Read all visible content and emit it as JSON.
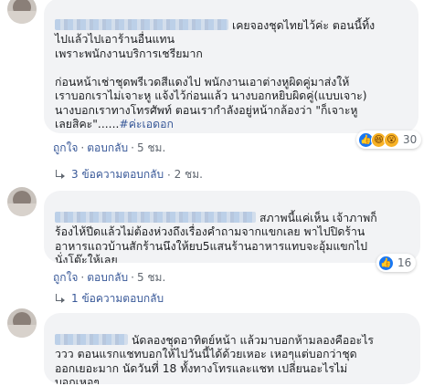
{
  "comments": [
    {
      "name": "",
      "text_first": "เคยจองชุดไทยไว้ค่ะ ตอนนี้ทิ้ง",
      "text_rest": "ไปแล้วไปเอาร้านอื่นแทน\nเพราะพนักงานบริการเชรียมาก\n\nก่อนหน้าเช่าชุดพรีเวดสีแดงไป พนักงานเอาต่างหูผิดคู่มาส่งให้\nเราบอกเราไม่เจาะหู แจ้งไว้ก่อนแล้ว นางบอกหยิบผิดคู่(แบบเจาะ)\nนางบอกเราทางโทรศัพท์ ตอนเรากำลังอยู่หน้ากล้องว่า \"ก็เจาะหู\nเลยสิคะ\"......",
      "hashtag": "#ค่ะเอดอก",
      "actions": {
        "like": "ถูกใจ",
        "reply": "ตอบกลับ",
        "time": "5 ชม."
      },
      "reactions": {
        "icons": [
          "like-icon",
          "haha-icon",
          "wow-icon"
        ],
        "count": "30"
      },
      "replies": {
        "label": "3 ข้อความตอบกลับ",
        "time": "2 ชม."
      }
    },
    {
      "name": "",
      "text_first": "สภาพนี้แค่เห็น เจ้าภาพก็",
      "text_rest": "ร้องไห้ปีดแล้วไม่ต้องห่วงถึงเรื่องคำถามจากแขกเลย พาไปปิดร้าน\nอาหารแถวบ้านสักร้านนึงให้ยบ5แสนร้านอาหารแทบจะอุ้มแขกไป\nนั่งโต๊ะให้เลย",
      "actions": {
        "like": "ถูกใจ",
        "reply": "ตอบกลับ",
        "time": "5 ชม."
      },
      "reactions": {
        "icons": [
          "like-icon"
        ],
        "count": "16"
      },
      "replies": {
        "label": "1 ข้อความตอบกลับ"
      }
    },
    {
      "name": "",
      "text_first": "นัดลองชุดอาทิตย์หน้า แล้วมาบอกห้ามลองคืออะไร",
      "text_rest": "ววว ตอนแรกแชทบอกให้ไปวันนี้ได้ด้วยเหอะ เหอๆแต่บอกว่าชุด\nออกเยอะมาก นัดวันที่ 18 ทั้งทางโทรและแชท เปลี่ยนอะไรไม่\nบอกเหอๆ"
    }
  ],
  "colors": {
    "bubble_bg": "#f2f3f5",
    "link": "#385898",
    "meta": "#606770",
    "like_blue": "#1877f2",
    "haha_yellow": "#f7b125"
  }
}
